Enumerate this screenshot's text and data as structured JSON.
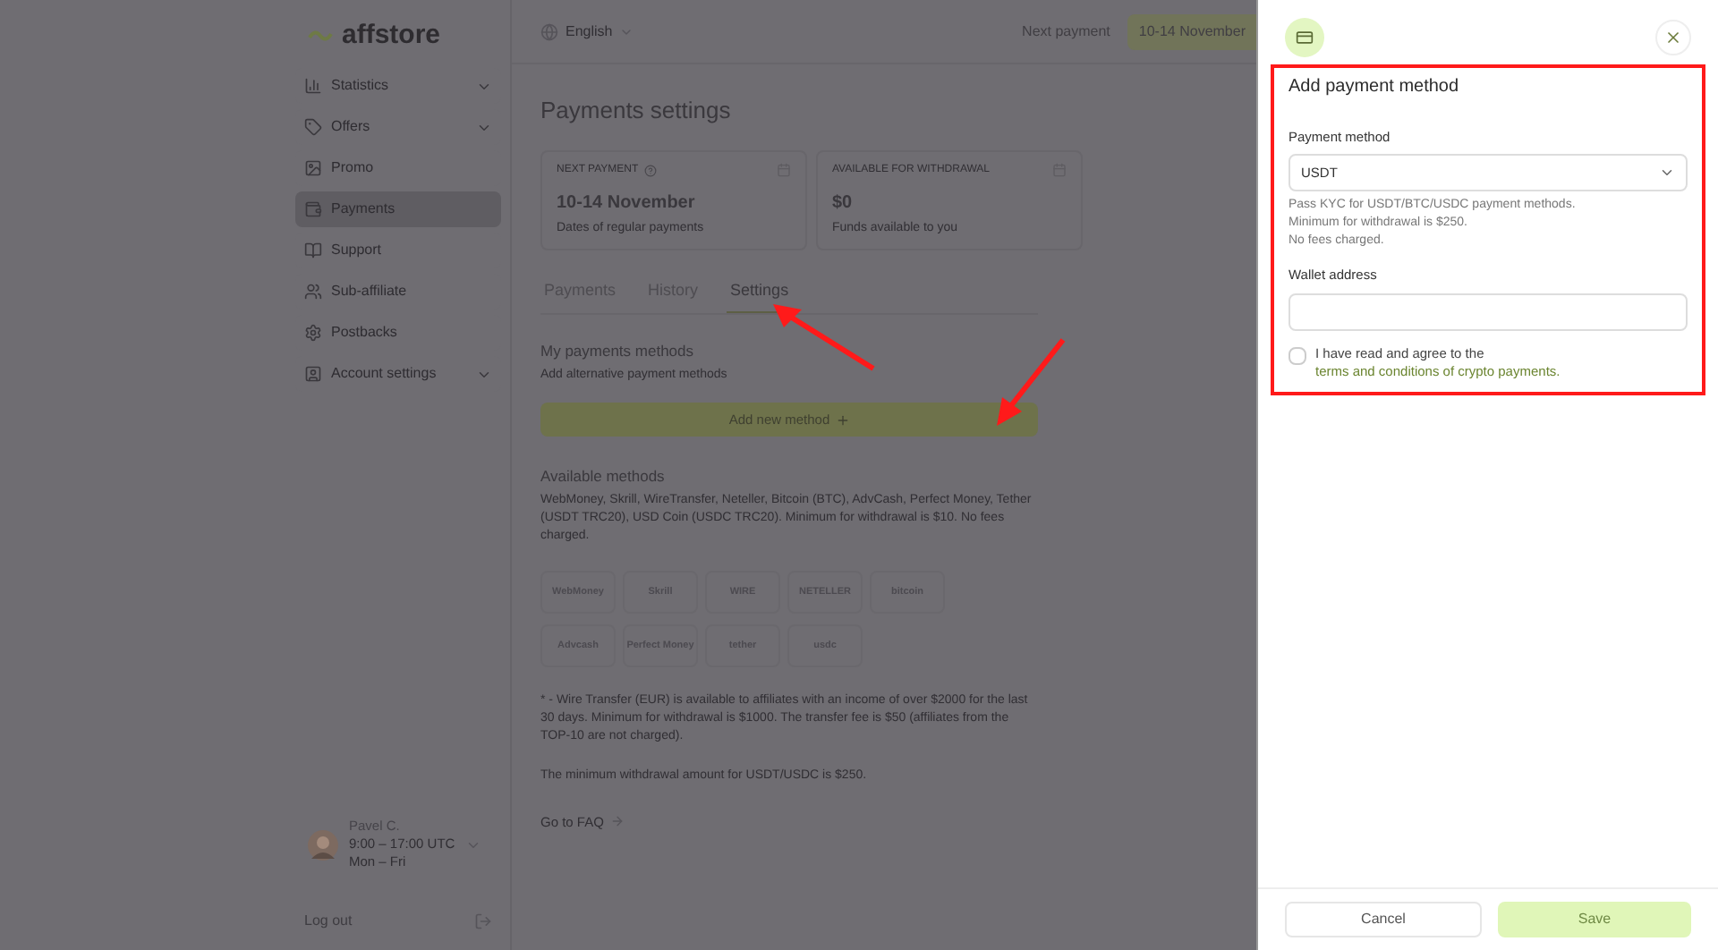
{
  "brand": "affstore",
  "language": "English",
  "header": {
    "next_label": "Next payment",
    "next_value": "10-14 November"
  },
  "sidebar": {
    "items": [
      {
        "label": "Statistics",
        "selected": false,
        "expandable": true
      },
      {
        "label": "Offers",
        "selected": false,
        "expandable": true
      },
      {
        "label": "Promo",
        "selected": false,
        "expandable": false
      },
      {
        "label": "Payments",
        "selected": true,
        "expandable": false
      },
      {
        "label": "Support",
        "selected": false,
        "expandable": false
      },
      {
        "label": "Sub-affiliate",
        "selected": false,
        "expandable": false
      },
      {
        "label": "Postbacks",
        "selected": false,
        "expandable": false
      },
      {
        "label": "Account settings",
        "selected": false,
        "expandable": true
      }
    ],
    "manager": {
      "name": "Pavel C.",
      "hours": "9:00 – 17:00 UTC",
      "days": "Mon – Fri"
    },
    "logout": "Log out"
  },
  "page": {
    "title": "Payments settings",
    "cards": [
      {
        "caption": "NEXT PAYMENT",
        "value": "10-14 November",
        "note": "Dates of regular payments",
        "help": true
      },
      {
        "caption": "AVAILABLE FOR WITHDRAWAL",
        "value": "$0",
        "note": "Funds available to you",
        "help": false
      }
    ],
    "tabs": [
      {
        "label": "Payments",
        "selected": false
      },
      {
        "label": "History",
        "selected": false
      },
      {
        "label": "Settings",
        "selected": true
      }
    ],
    "my_methods": {
      "title": "My payments methods",
      "subtitle": "Add alternative payment methods",
      "button": "Add new method"
    },
    "available": {
      "title": "Available methods",
      "text": "WebMoney, Skrill, WireTransfer, Neteller, Bitcoin (BTC), AdvCash, Perfect Money, Tether (USDT TRC20), USD Coin (USDC TRC20). Minimum for withdrawal is $10. No fees charged.",
      "logos": [
        [
          "WebMoney",
          "Skrill",
          "WIRE",
          "NETELLER",
          "bitcoin"
        ],
        [
          "Advcash",
          "Perfect Money",
          "tether",
          "usdc"
        ]
      ]
    },
    "footnote": "* - Wire Transfer (EUR) is available to affiliates with an income of over $2000 for the last 30 days. Minimum for withdrawal is $1000. The transfer fee is $50 (affiliates from the TOP-10 are not charged).",
    "min_note": "The minimum withdrawal amount for USDT/USDC is $250.",
    "faq": "Go to FAQ"
  },
  "panel": {
    "title": "Add payment method",
    "method_label": "Payment method",
    "method_value": "USDT",
    "hints": [
      "Pass KYC for USDT/BTC/USDC payment methods.",
      "Minimum for withdrawal is $250.",
      "No fees charged."
    ],
    "wallet_label": "Wallet address",
    "agree_text": "I have read and agree to the ",
    "agree_link": "terms and conditions of crypto payments.",
    "agree_checked": false,
    "cancel": "Cancel",
    "save": "Save",
    "save_disabled": true
  }
}
